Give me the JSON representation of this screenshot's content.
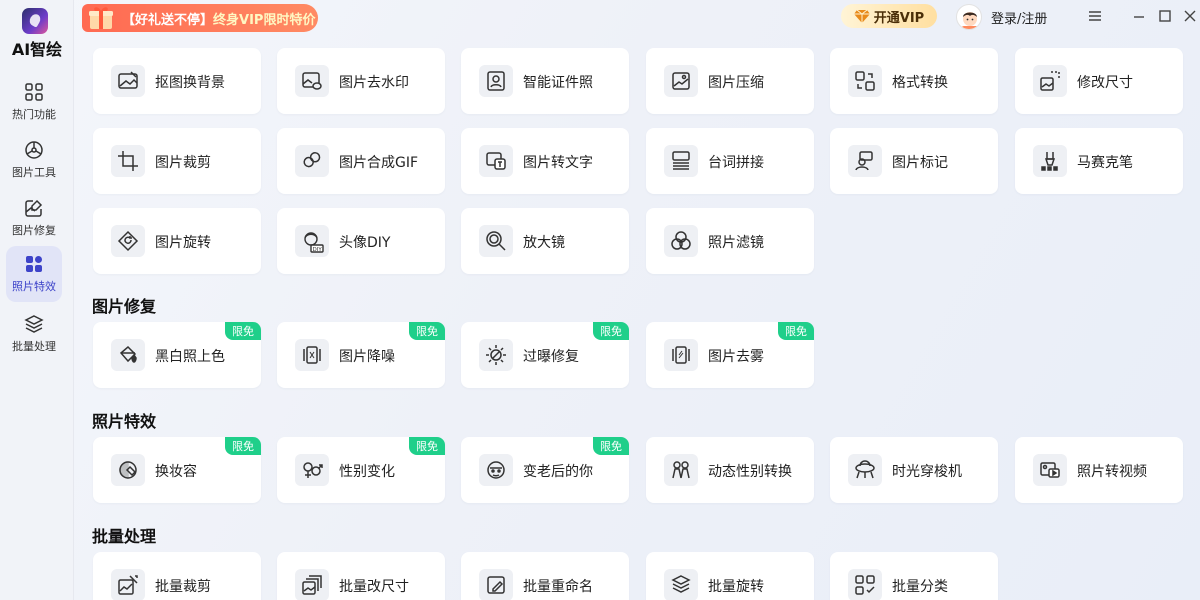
{
  "sidebar": {
    "app_name": "AI智绘",
    "items": [
      {
        "label": "热门功能"
      },
      {
        "label": "图片工具"
      },
      {
        "label": "图片修复"
      },
      {
        "label": "照片特效"
      },
      {
        "label": "批量处理"
      }
    ]
  },
  "topbar": {
    "promo_bracket": "【好礼送不停】",
    "promo_text": "终身VIP限时特价",
    "vip_label": "开通VIP",
    "login_label": "登录/注册"
  },
  "tools": {
    "row1": [
      "抠图换背景",
      "图片去水印",
      "智能证件照",
      "图片压缩",
      "格式转换",
      "修改尺寸"
    ],
    "row2": [
      "图片裁剪",
      "图片合成GIF",
      "图片转文字",
      "台词拼接",
      "图片标记",
      "马赛克笔"
    ],
    "row3": [
      "图片旋转",
      "头像DIY",
      "放大镜",
      "照片滤镜"
    ]
  },
  "repair": {
    "title": "图片修复",
    "items": [
      "黑白照上色",
      "图片降噪",
      "过曝修复",
      "图片去雾"
    ],
    "badge": "限免"
  },
  "effects": {
    "title": "照片特效",
    "items": [
      "换妆容",
      "性别变化",
      "变老后的你",
      "动态性别转换",
      "时光穿梭机",
      "照片转视频"
    ],
    "badge": "限免"
  },
  "batch": {
    "title": "批量处理",
    "items": [
      "批量裁剪",
      "批量改尺寸",
      "批量重命名",
      "批量旋转",
      "批量分类"
    ]
  },
  "colors": {
    "accent": "#3d43c9",
    "badge": "#1fcf8a",
    "promo": "#ff6a52",
    "vip_gold": "#ffdfa0"
  }
}
